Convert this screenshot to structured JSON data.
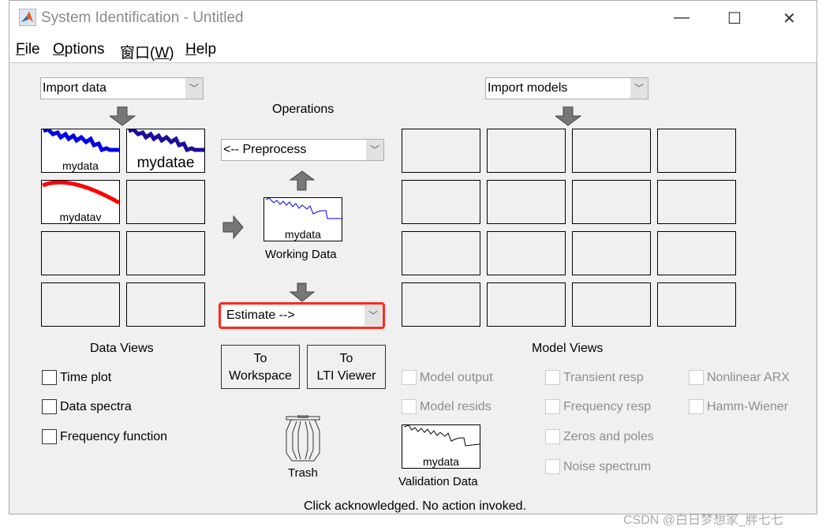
{
  "window": {
    "title": "System Identification - Untitled",
    "minimize": "—",
    "maximize": "☐",
    "close": "✕"
  },
  "menu": [
    {
      "label": "File",
      "key": "F",
      "rest": "ile"
    },
    {
      "label": "Options",
      "key": "O",
      "rest": "ptions"
    },
    {
      "label": "窗口(W)",
      "pre": "窗口(",
      "key": "W",
      "rest": ")"
    },
    {
      "label": "Help",
      "key": "H",
      "rest": "elp"
    }
  ],
  "data_panel": {
    "import_select": "Import data",
    "slots": [
      {
        "name": "mydata",
        "color": "#0000e6"
      },
      {
        "name": "mydatae",
        "color": "#1a0d99"
      },
      {
        "name": "mydatav",
        "color": "#ff0000"
      }
    ],
    "title": "Data Views",
    "views": [
      {
        "label": "Time plot",
        "checked": false
      },
      {
        "label": "Data spectra",
        "checked": false
      },
      {
        "label": "Frequency function",
        "checked": false
      }
    ]
  },
  "operations": {
    "title": "Operations",
    "preprocess_select": "<-- Preprocess",
    "working_data": {
      "name": "mydata",
      "label": "Working Data"
    },
    "estimate_select": "Estimate -->",
    "highlight_color": "#ff0000",
    "to_workspace": [
      "To",
      "Workspace"
    ],
    "to_lti": [
      "To",
      "LTI Viewer"
    ],
    "trash": "Trash"
  },
  "model_panel": {
    "import_select": "Import models",
    "title": "Model Views",
    "views": [
      {
        "label": "Model output",
        "enabled": false
      },
      {
        "label": "Transient resp",
        "enabled": false
      },
      {
        "label": "Nonlinear ARX",
        "enabled": false
      },
      {
        "label": "Model resids",
        "enabled": false
      },
      {
        "label": "Frequency resp",
        "enabled": false
      },
      {
        "label": "Hamm-Wiener",
        "enabled": false
      },
      {
        "label": "Zeros and poles",
        "enabled": false
      },
      {
        "label": "Noise spectrum",
        "enabled": false
      }
    ],
    "validation_data": {
      "name": "mydata",
      "label": "Validation Data"
    }
  },
  "status": "Click acknowledged. No action invoked.",
  "watermark": "CSDN @白日梦想家_胖七七"
}
